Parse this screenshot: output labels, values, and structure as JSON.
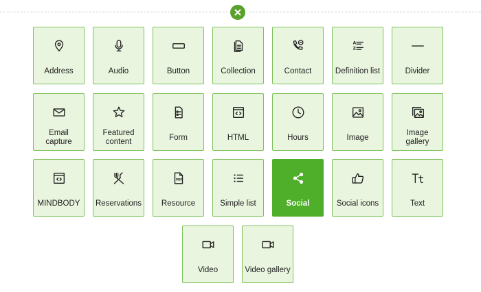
{
  "close_button": {
    "icon": "close-icon",
    "color": "#5aa02c"
  },
  "colors": {
    "tile_bg": "#e9f5de",
    "tile_border": "#7cc25a",
    "active_bg": "#4fae2a"
  },
  "tiles": [
    {
      "label": "Address",
      "icon": "map-pin-icon",
      "selected": false
    },
    {
      "label": "Audio",
      "icon": "microphone-icon",
      "selected": false
    },
    {
      "label": "Button",
      "icon": "button-icon",
      "selected": false
    },
    {
      "label": "Collection",
      "icon": "collection-icon",
      "selected": false
    },
    {
      "label": "Contact",
      "icon": "phone-chat-icon",
      "selected": false
    },
    {
      "label": "Definition list",
      "icon": "definition-list-icon",
      "selected": false
    },
    {
      "label": "Divider",
      "icon": "divider-icon",
      "selected": false
    },
    {
      "label": "Email capture",
      "icon": "envelope-icon",
      "selected": false
    },
    {
      "label": "Featured content",
      "icon": "star-icon",
      "selected": false
    },
    {
      "label": "Form",
      "icon": "form-icon",
      "selected": false
    },
    {
      "label": "HTML",
      "icon": "code-window-icon",
      "selected": false
    },
    {
      "label": "Hours",
      "icon": "clock-icon",
      "selected": false
    },
    {
      "label": "Image",
      "icon": "image-icon",
      "selected": false
    },
    {
      "label": "Image gallery",
      "icon": "image-gallery-icon",
      "selected": false
    },
    {
      "label": "MINDBODY",
      "icon": "mindbody-icon",
      "selected": false
    },
    {
      "label": "Reservations",
      "icon": "fork-knife-icon",
      "selected": false
    },
    {
      "label": "Resource",
      "icon": "pdf-file-icon",
      "selected": false
    },
    {
      "label": "Simple list",
      "icon": "list-icon",
      "selected": false
    },
    {
      "label": "Social",
      "icon": "share-icon",
      "selected": true
    },
    {
      "label": "Social icons",
      "icon": "thumbs-up-icon",
      "selected": false
    },
    {
      "label": "Text",
      "icon": "text-icon",
      "selected": false
    },
    {
      "label": "Video",
      "icon": "video-camera-icon",
      "selected": false
    },
    {
      "label": "Video gallery",
      "icon": "video-gallery-icon",
      "selected": false
    }
  ]
}
